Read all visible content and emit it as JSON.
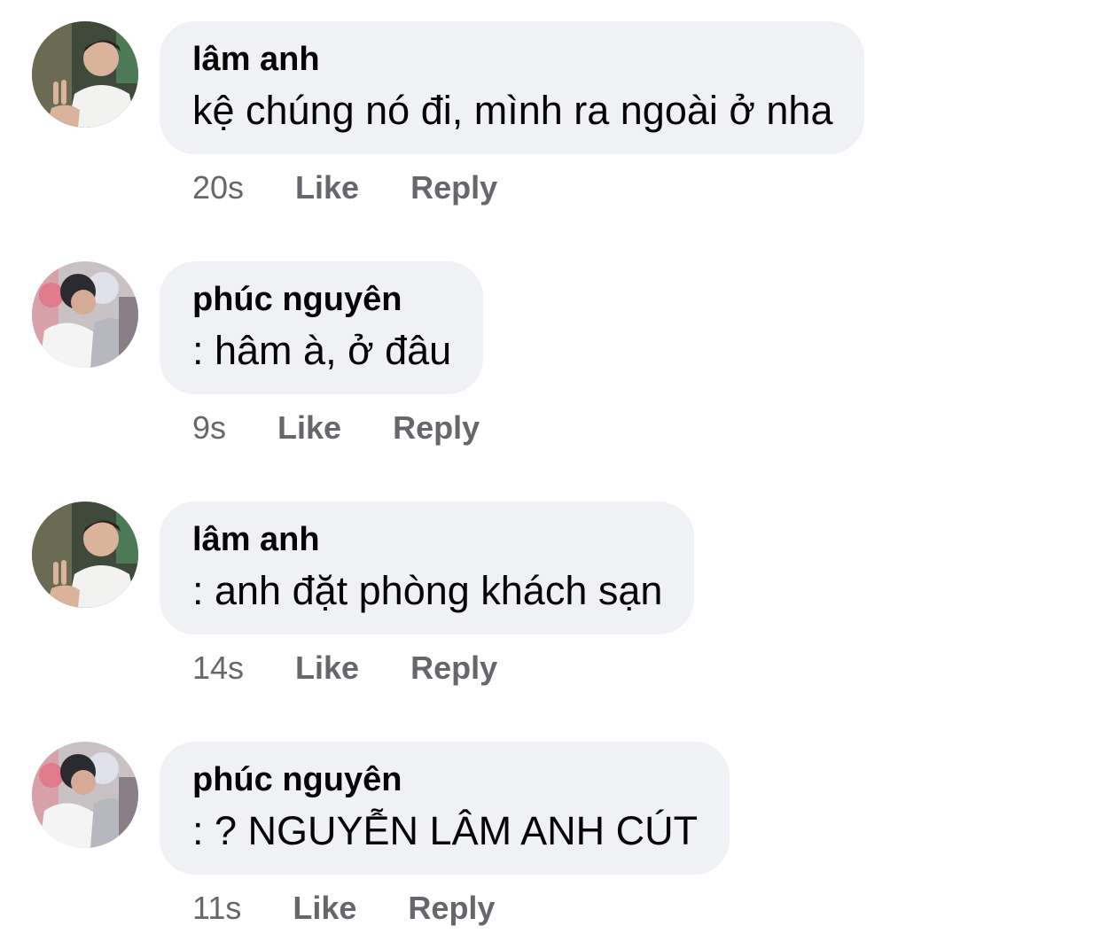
{
  "comments": [
    {
      "author": "lâm anh",
      "text": "kệ chúng nó đi, mình ra ngoài ở nha",
      "time": "20s",
      "like_label": "Like",
      "reply_label": "Reply",
      "avatar_icon": "avatar-lam-anh"
    },
    {
      "author": "phúc nguyên",
      "text": ": hâm à, ở đâu",
      "time": "9s",
      "like_label": "Like",
      "reply_label": "Reply",
      "avatar_icon": "avatar-phuc-nguyen"
    },
    {
      "author": "lâm anh",
      "text": ": anh đặt phòng khách sạn",
      "time": "14s",
      "like_label": "Like",
      "reply_label": "Reply",
      "avatar_icon": "avatar-lam-anh"
    },
    {
      "author": "phúc nguyên",
      "text": ": ? NGUYỄN LÂM ANH CÚT",
      "time": "11s",
      "like_label": "Like",
      "reply_label": "Reply",
      "avatar_icon": "avatar-phuc-nguyen"
    }
  ],
  "colors": {
    "bubble_bg": "#f0f1f5",
    "text_primary": "#050505",
    "text_secondary": "#65676b",
    "background": "#ffffff"
  }
}
